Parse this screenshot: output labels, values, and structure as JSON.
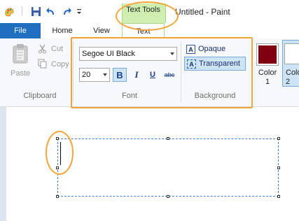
{
  "window": {
    "title": "Untitled - Paint"
  },
  "quick_access": {
    "icons": [
      "paint-app-icon",
      "save-icon",
      "undo-icon",
      "redo-icon",
      "customize-qat-icon"
    ]
  },
  "context_tab": {
    "group_label": "Text Tools",
    "tab_label": "Text"
  },
  "tabs": {
    "file": "File",
    "home": "Home",
    "view": "View"
  },
  "clipboard": {
    "paste": "Paste",
    "cut": "Cut",
    "copy": "Copy",
    "group_label": "Clipboard"
  },
  "font": {
    "family": "Segoe UI Black",
    "size": "20",
    "bold": "B",
    "italic": "I",
    "underline": "U",
    "strikethrough": "abc",
    "group_label": "Font"
  },
  "background": {
    "opaque": "Opaque",
    "transparent": "Transparent",
    "selected": "Transparent",
    "group_label": "Background"
  },
  "colors": {
    "color1_label": "Color",
    "color1_num": "1",
    "color1_value": "#800010",
    "color2_label": "Colo",
    "color2_num": "2",
    "color2_value": "#ffffff",
    "accent": "#1e6fc0",
    "annotation": "#f3a53a"
  }
}
